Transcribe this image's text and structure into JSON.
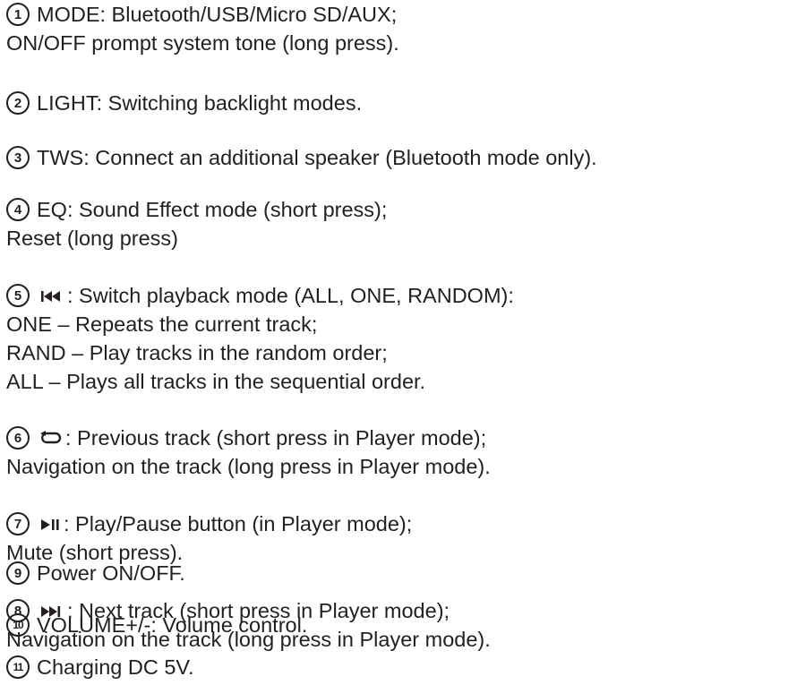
{
  "items": [
    {
      "number": "1",
      "icon": "",
      "lines": [
        "MODE: Bluetooth/USB/Micro SD/AUX;",
        "ON/OFF prompt system tone (long press)."
      ]
    },
    {
      "number": "2",
      "icon": "",
      "lines": [
        "LIGHT: Switching backlight modes."
      ]
    },
    {
      "number": "3",
      "icon": "",
      "lines": [
        "TWS: Connect an additional speaker (Bluetooth mode only)."
      ]
    },
    {
      "number": "4",
      "icon": "",
      "lines": [
        "EQ: Sound Effect mode (short press);",
        "Reset (long press)"
      ]
    },
    {
      "number": "5",
      "icon": "previous-track-icon",
      "lines": [
        ": Switch playback mode (ALL, ONE, RANDOM):",
        "ONE – Repeats the current track;",
        "RAND – Play tracks in the random order;",
        "ALL – Plays all tracks in the sequential order."
      ]
    },
    {
      "number": "6",
      "icon": "repeat-icon",
      "lines": [
        ": Previous track (short press in Player mode);",
        "Navigation on the track (long press in Player mode)."
      ]
    },
    {
      "number": "7",
      "icon": "play-pause-icon",
      "lines": [
        ": Play/Pause button (in Player mode);",
        "Mute (short press)."
      ]
    },
    {
      "number": "8",
      "icon": "next-track-icon",
      "lines": [
        ": Next track (short press in Player mode);",
        "Navigation on the track (long press in Player mode)."
      ]
    },
    {
      "number": "9",
      "icon": "",
      "lines": [
        "Power ON/OFF."
      ]
    },
    {
      "number": "10",
      "icon": "",
      "lines": [
        "VOLUME+/-: Volume control."
      ]
    },
    {
      "number": "11",
      "icon": "",
      "lines": [
        "Charging DC 5V."
      ]
    }
  ]
}
